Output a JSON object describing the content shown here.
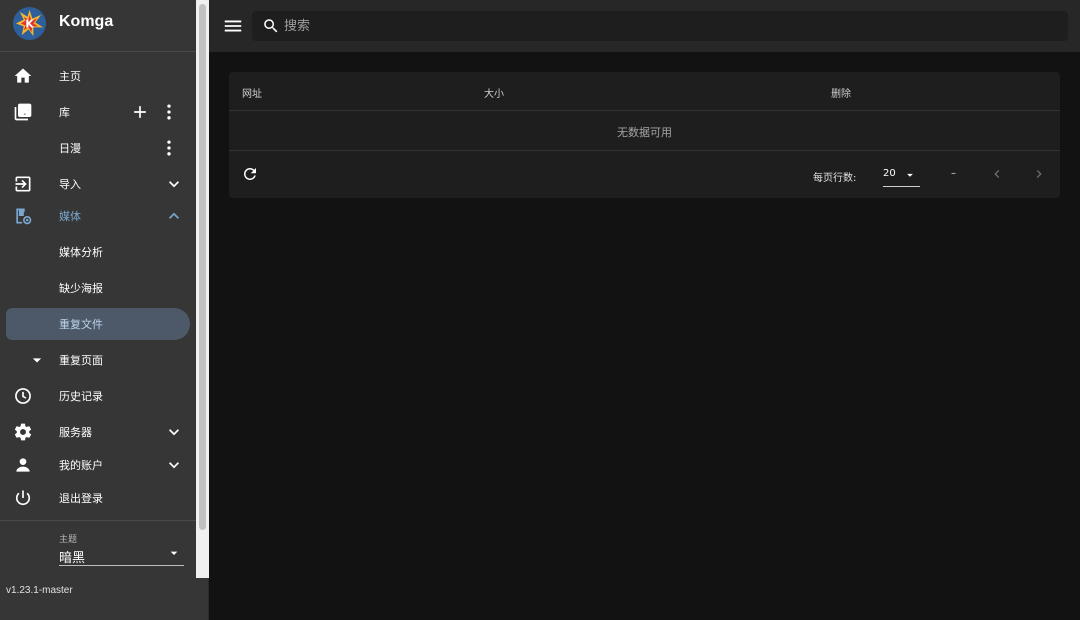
{
  "app": {
    "name": "Komga",
    "version": "v1.23.1-master"
  },
  "sidebar": {
    "items": [
      {
        "label": "主页",
        "icon": "home-icon"
      },
      {
        "label": "库",
        "icon": "library-icon"
      },
      {
        "label": "日漫"
      },
      {
        "label": "导入",
        "icon": "import-icon"
      },
      {
        "label": "媒体",
        "icon": "media-icon"
      },
      {
        "label": "媒体分析"
      },
      {
        "label": "缺少海报"
      },
      {
        "label": "重复文件"
      },
      {
        "label": "重复页面"
      },
      {
        "label": "历史记录",
        "icon": "history-icon"
      },
      {
        "label": "服务器",
        "icon": "gear-icon"
      },
      {
        "label": "我的账户",
        "icon": "account-icon"
      },
      {
        "label": "退出登录",
        "icon": "power-icon"
      }
    ],
    "theme": {
      "caption": "主题",
      "value": "暗黑"
    }
  },
  "header": {
    "search_placeholder": "搜索"
  },
  "table": {
    "columns": [
      "网址",
      "大小",
      "删除"
    ],
    "empty_text": "无数据可用",
    "rows_per_page_label": "每页行数:",
    "rows_per_page_value": "20",
    "range_text": "–"
  },
  "colors": {
    "accent": "#79a7cf",
    "selected_bg": "#4d5968",
    "sidebar_bg": "#363636",
    "main_bg": "#121212"
  }
}
